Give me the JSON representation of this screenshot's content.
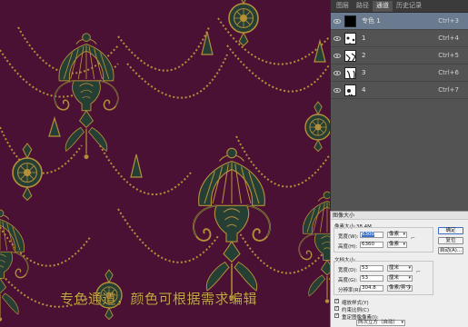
{
  "caption": "专色通道，颜色可根据需求编辑",
  "channels_panel": {
    "tabs": [
      "图层",
      "路径",
      "通道",
      "历史记录"
    ],
    "active_tab": "通道",
    "rows": [
      {
        "name": "专色 1",
        "shortcut": "Ctrl+3",
        "selected": true,
        "thumb": "black"
      },
      {
        "name": "1",
        "shortcut": "Ctrl+4",
        "selected": false,
        "thumb": "pattern"
      },
      {
        "name": "2",
        "shortcut": "Ctrl+5",
        "selected": false,
        "thumb": "pattern"
      },
      {
        "name": "3",
        "shortcut": "Ctrl+6",
        "selected": false,
        "thumb": "pattern"
      },
      {
        "name": "4",
        "shortcut": "Ctrl+7",
        "selected": false,
        "thumb": "pattern"
      }
    ]
  },
  "dialog": {
    "title": "图像大小",
    "pixel_dims_label": "像素大小:38.4M",
    "width_label": "宽度(W):",
    "width_value": "6300",
    "width_unit": "像素",
    "height_label": "高度(H):",
    "height_value": "6360",
    "height_unit": "像素",
    "doc_size_label": "文档大小:",
    "doc_width_label": "宽度(D):",
    "doc_width_value": "53",
    "doc_width_unit": "厘米",
    "doc_height_label": "高度(G):",
    "doc_height_value": "53",
    "doc_height_unit": "厘米",
    "resolution_label": "分辨率(R):",
    "resolution_value": "304.8",
    "resolution_unit": "像素/英寸",
    "ok_label": "确定",
    "reset_label": "复位",
    "auto_label": "自动(A)...",
    "scale_styles_label": "缩放样式(Y)",
    "constrain_label": "约束比例(C)",
    "resample_label": "重定图像像素(I):",
    "resample_method": "两次立方（自动）"
  },
  "colors": {
    "canvas_bg": "#4b1134",
    "ornament_gold": "#b48f3a",
    "ornament_green": "#263f35",
    "panel_bg": "#535353",
    "selected_row": "#6a7b8f"
  }
}
